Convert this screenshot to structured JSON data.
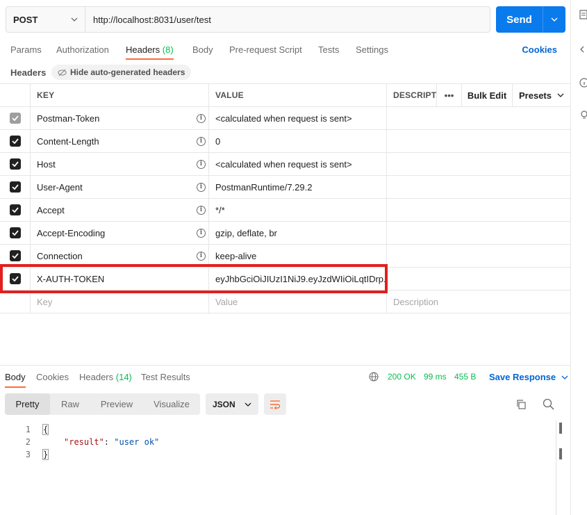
{
  "request": {
    "method": "POST",
    "url": "http://localhost:8031/user/test",
    "send_label": "Send"
  },
  "tabs": {
    "params": "Params",
    "authorization": "Authorization",
    "headers": "Headers",
    "headers_count": "(8)",
    "body": "Body",
    "prerequest": "Pre-request Script",
    "tests": "Tests",
    "settings": "Settings",
    "cookies": "Cookies"
  },
  "headers_section": {
    "title": "Headers",
    "hide_label": "Hide auto-generated headers"
  },
  "table": {
    "columns": {
      "key": "KEY",
      "value": "VALUE",
      "description": "DESCRIPTI"
    },
    "more": "•••",
    "bulk_edit": "Bulk Edit",
    "presets": "Presets",
    "rows": [
      {
        "key": "Postman-Token",
        "value": "<calculated when request is sent>"
      },
      {
        "key": "Content-Length",
        "value": "0"
      },
      {
        "key": "Host",
        "value": "<calculated when request is sent>"
      },
      {
        "key": "User-Agent",
        "value": "PostmanRuntime/7.29.2"
      },
      {
        "key": "Accept",
        "value": "*/*"
      },
      {
        "key": "Accept-Encoding",
        "value": "gzip, deflate, br"
      },
      {
        "key": "Connection",
        "value": "keep-alive"
      },
      {
        "key": "X-AUTH-TOKEN",
        "value": "eyJhbGciOiJIUzI1NiJ9.eyJzdWIiOiLqtIDrp..."
      }
    ],
    "placeholder": {
      "key": "Key",
      "value": "Value",
      "description": "Description"
    }
  },
  "response": {
    "tabs": {
      "body": "Body",
      "cookies": "Cookies",
      "headers": "Headers",
      "headers_count": "(14)",
      "test_results": "Test Results"
    },
    "status": "200 OK",
    "time": "99 ms",
    "size": "455 B",
    "save_label": "Save Response",
    "modes": {
      "pretty": "Pretty",
      "raw": "Raw",
      "preview": "Preview",
      "visualize": "Visualize"
    },
    "format": "JSON",
    "line_numbers": [
      "1",
      "2",
      "3"
    ],
    "body_open": "{",
    "body_key": "\"result\"",
    "body_colon": ": ",
    "body_value": "\"user ok\"",
    "body_close": "}"
  },
  "colors": {
    "accent": "#ff6c37",
    "send": "#097bed",
    "link": "#0265d2",
    "success": "#0cbb52",
    "highlight": "#e0201e"
  },
  "icons": [
    "chevron-down-icon",
    "info-icon",
    "checkbox-icon",
    "globe-icon",
    "copy-icon",
    "search-icon",
    "wrap-icon",
    "eye-slash-icon"
  ]
}
